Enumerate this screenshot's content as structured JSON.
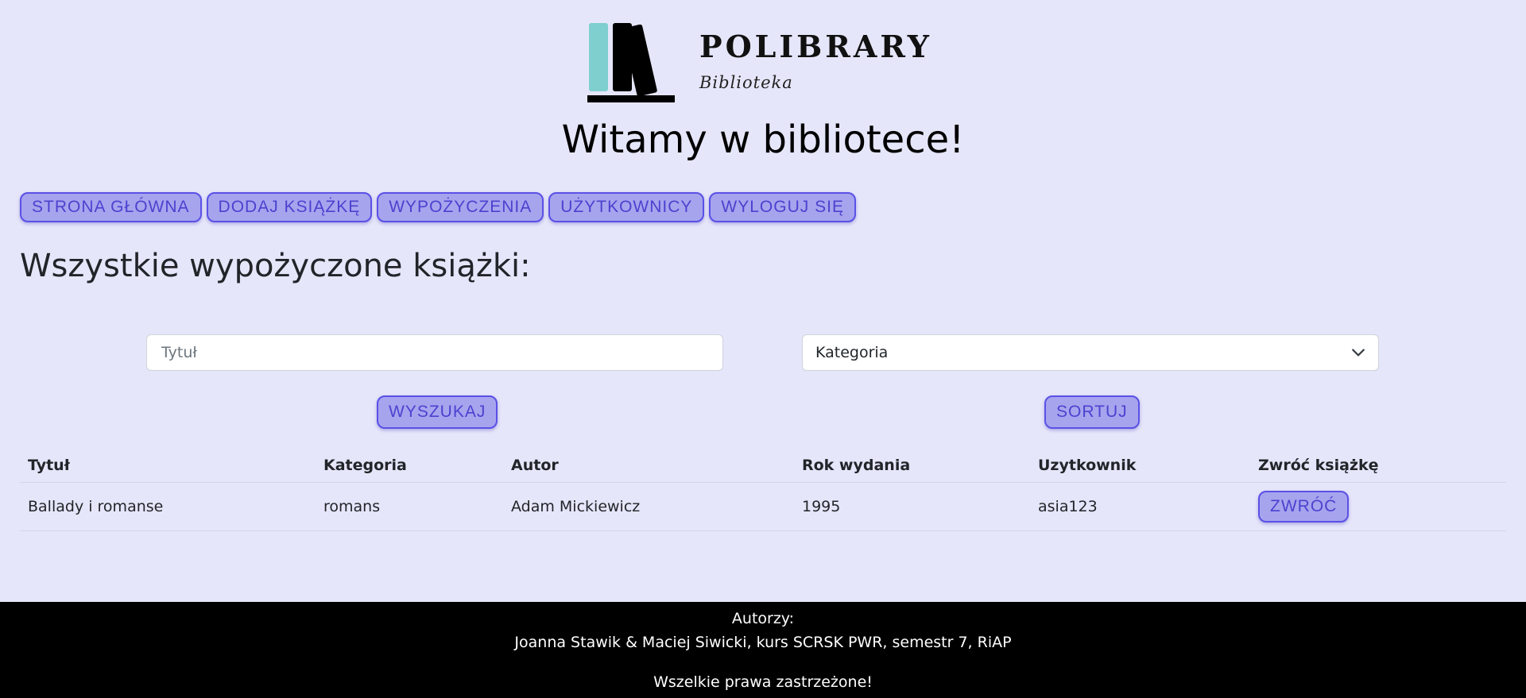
{
  "brand": {
    "name": "POLIBRARY",
    "subtitle": "Biblioteka",
    "logo_colors": {
      "teal": "#7fcfcf",
      "black": "#000000"
    }
  },
  "welcome": "Witamy w bibliotece!",
  "nav": {
    "items": [
      {
        "label": "STRONA GŁÓWNA"
      },
      {
        "label": "DODAJ KSIĄŻKĘ"
      },
      {
        "label": "WYPOŻYCZENIA"
      },
      {
        "label": "UŻYTKOWNICY"
      },
      {
        "label": "WYLOGUJ SIĘ"
      }
    ]
  },
  "section_title": "Wszystkie wypożyczone książki:",
  "filters": {
    "title_placeholder": "Tytuł",
    "title_value": "",
    "category_selected": "Kategoria",
    "search_label": "WYSZUKAJ",
    "sort_label": "SORTUJ"
  },
  "table": {
    "headers": [
      "Tytuł",
      "Kategoria",
      "Autor",
      "Rok wydania",
      "Uzytkownik",
      "Zwróć książkę"
    ],
    "rows": [
      {
        "title": "Ballady i romanse",
        "category": "romans",
        "author": "Adam Mickiewicz",
        "year": "1995",
        "user": "asia123",
        "action_label": "ZWRÓĆ"
      }
    ]
  },
  "footer": {
    "authors_label": "Autorzy:",
    "authors": "Joanna Stawik & Maciej Siwicki, kurs SCRSK PWR, semestr 7, RiAP",
    "rights": "Wszelkie prawa zastrzeżone!"
  },
  "colors": {
    "background": "#e6e6fa",
    "button_fill": "#a7a4ee",
    "button_border": "#5a51e6",
    "button_text": "#4b42cf",
    "footer_bg": "#000000"
  }
}
